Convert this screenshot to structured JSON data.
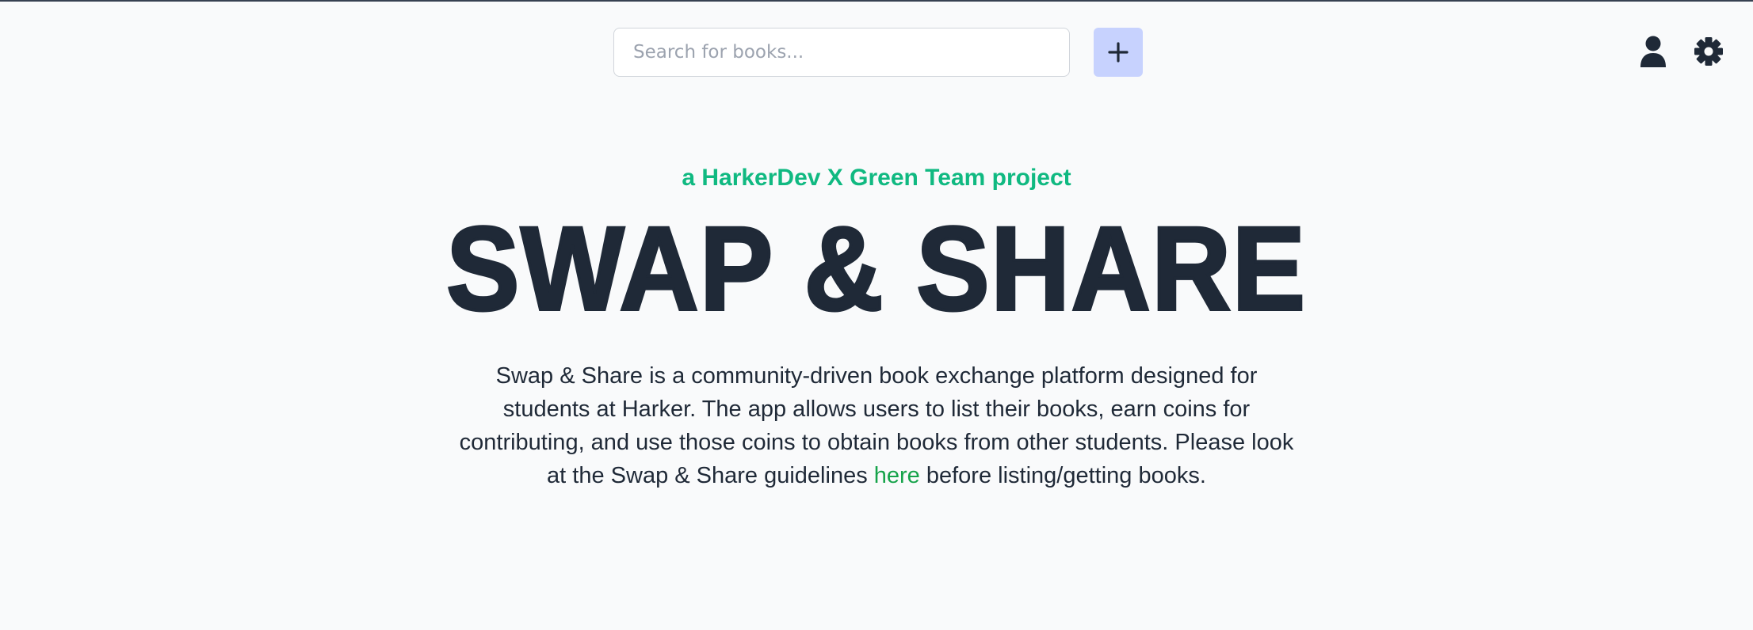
{
  "header": {
    "search": {
      "placeholder": "Search for books...",
      "value": ""
    },
    "add_label": "+",
    "icons": {
      "add": "plus-icon",
      "user": "user-icon",
      "settings": "gear-icon"
    }
  },
  "hero": {
    "tagline": "a HarkerDev X Green Team project",
    "title": "SWAP & SHARE",
    "description_before": "Swap & Share is a community-driven book exchange platform designed for students at Harker. The app allows users to list their books, earn coins for contributing, and use those coins to obtain books from other students. Please look at the Swap & Share guidelines ",
    "link_text": "here",
    "description_after": " before listing/getting books."
  },
  "colors": {
    "background": "#f9fafb",
    "accent_green": "#10b981",
    "link_green": "#16a34a",
    "add_button_bg": "#c7d2fe",
    "text_dark": "#1f2937"
  }
}
